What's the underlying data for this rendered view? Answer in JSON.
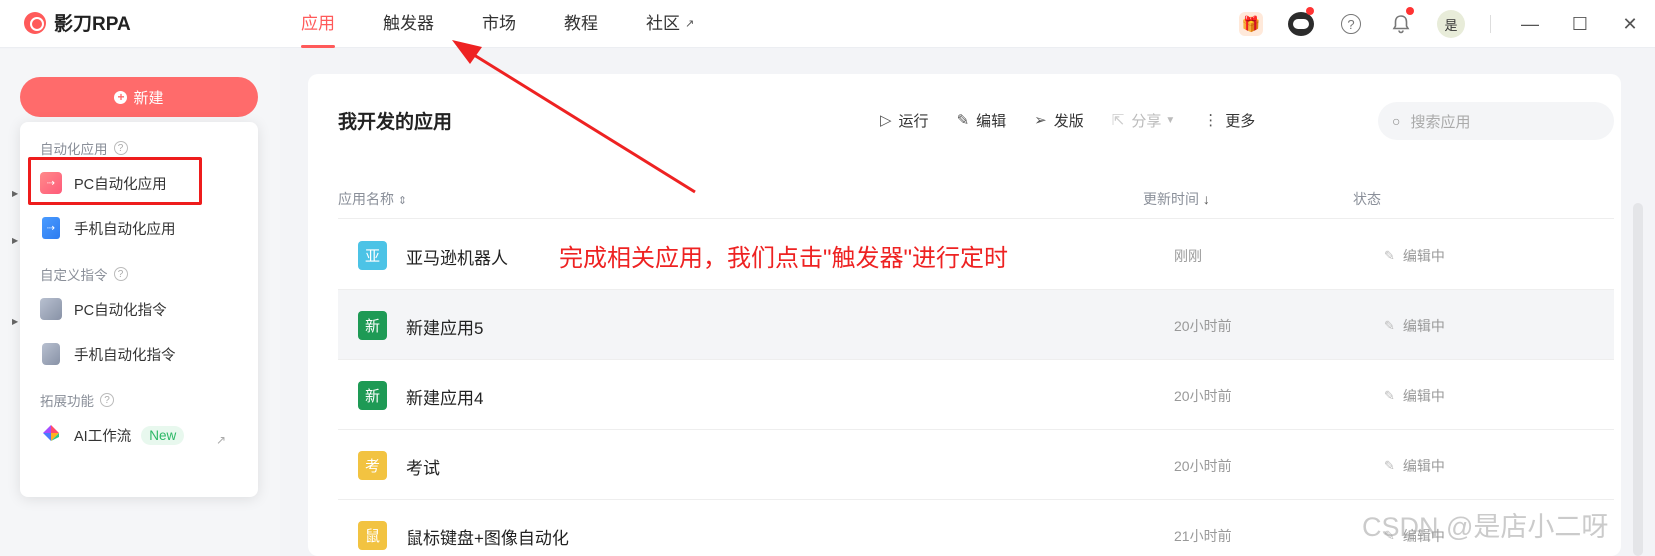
{
  "app": {
    "logo_text": "影刀RPA"
  },
  "nav": {
    "items": [
      {
        "label": "应用",
        "active": true
      },
      {
        "label": "触发器",
        "active": false
      },
      {
        "label": "市场",
        "active": false
      },
      {
        "label": "教程",
        "active": false
      },
      {
        "label": "社区",
        "active": false,
        "external": true
      }
    ]
  },
  "top_icons": {
    "gift": "gift-icon",
    "mascot": "mascot-icon",
    "help": "?",
    "bell": "bell-icon",
    "avatar_label": "是"
  },
  "window": {
    "minimize": "—",
    "maximize": "☐",
    "close": "✕"
  },
  "sidebar": {
    "new_button": "新建",
    "popup": {
      "sections": [
        {
          "title": "自动化应用",
          "items": [
            "PC自动化应用",
            "手机自动化应用"
          ]
        },
        {
          "title": "自定义指令",
          "items": [
            "PC自动化指令",
            "手机自动化指令"
          ]
        },
        {
          "title": "拓展功能",
          "items": [
            "AI工作流"
          ]
        }
      ],
      "badge": "New"
    }
  },
  "main": {
    "title": "我开发的应用",
    "toolbar": {
      "run": "运行",
      "edit": "编辑",
      "publish": "发版",
      "share": "分享",
      "more": "更多"
    },
    "search_placeholder": "搜索应用",
    "columns": {
      "name": "应用名称",
      "updated": "更新时间",
      "status": "状态"
    },
    "rows": [
      {
        "icon_char": "亚",
        "icon_color": "#4cc3e6",
        "name": "亚马逊机器人",
        "updated": "刚刚",
        "status": "编辑中"
      },
      {
        "icon_char": "新",
        "icon_color": "#1e9a55",
        "name": "新建应用5",
        "updated": "20小时前",
        "status": "编辑中"
      },
      {
        "icon_char": "新",
        "icon_color": "#1e9a55",
        "name": "新建应用4",
        "updated": "20小时前",
        "status": "编辑中"
      },
      {
        "icon_char": "考",
        "icon_color": "#f2c341",
        "name": "考试",
        "updated": "20小时前",
        "status": "编辑中"
      },
      {
        "icon_char": "鼠",
        "icon_color": "#f2c341",
        "name": "鼠标键盘+图像自动化",
        "updated": "21小时前",
        "status": "编辑中"
      }
    ]
  },
  "annotation": {
    "text": "完成相关应用，我们点击\"触发器\"进行定时",
    "color": "#ee2222"
  },
  "watermark": "CSDN @是店小二呀",
  "colors": {
    "accent": "#ff5a5a",
    "new_button": "#ff6b6b"
  }
}
